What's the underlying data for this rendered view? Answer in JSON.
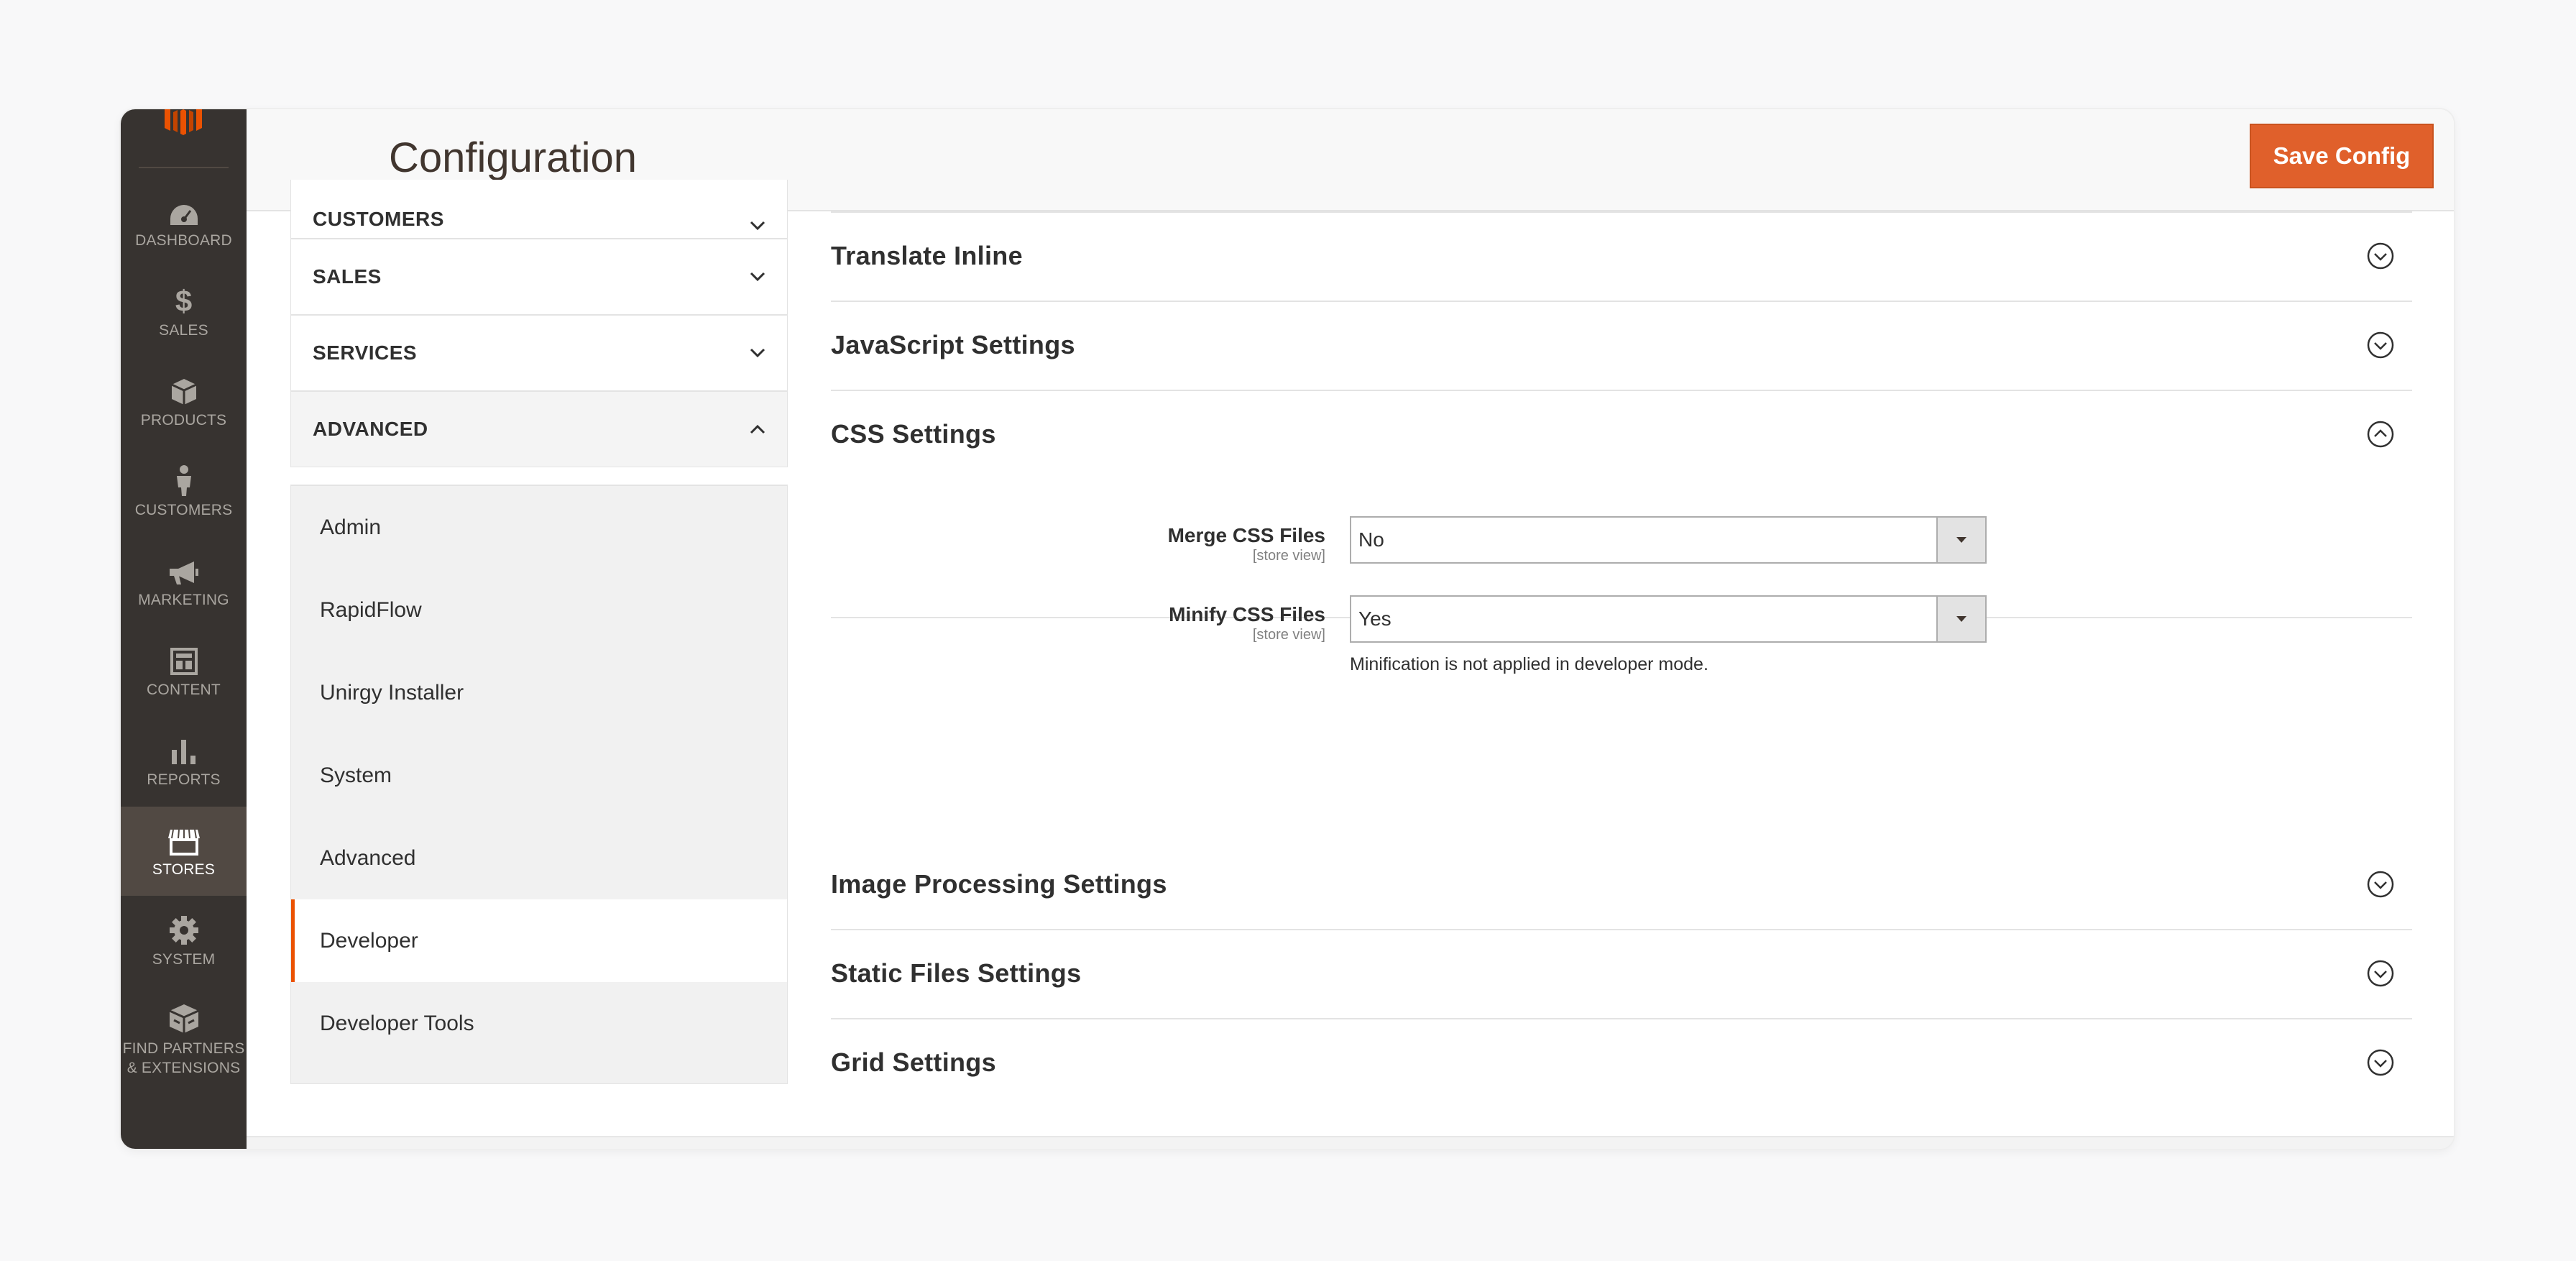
{
  "header": {
    "title": "Configuration",
    "save_label": "Save Config"
  },
  "nav": {
    "items": [
      {
        "label": "DASHBOARD",
        "icon": "dashboard-icon"
      },
      {
        "label": "SALES",
        "icon": "dollar-icon"
      },
      {
        "label": "PRODUCTS",
        "icon": "box-icon"
      },
      {
        "label": "CUSTOMERS",
        "icon": "person-icon"
      },
      {
        "label": "MARKETING",
        "icon": "megaphone-icon"
      },
      {
        "label": "CONTENT",
        "icon": "layout-icon"
      },
      {
        "label": "REPORTS",
        "icon": "bar-chart-icon"
      },
      {
        "label": "STORES",
        "icon": "store-icon"
      },
      {
        "label": "SYSTEM",
        "icon": "gear-icon"
      },
      {
        "label": "FIND PARTNERS & EXTENSIONS",
        "icon": "extensions-icon"
      }
    ],
    "active": "STORES"
  },
  "tabs": {
    "groups": [
      {
        "label": "CUSTOMERS"
      },
      {
        "label": "SALES"
      },
      {
        "label": "SERVICES"
      },
      {
        "label": "ADVANCED"
      }
    ],
    "advanced_items": [
      {
        "label": "Admin"
      },
      {
        "label": "RapidFlow"
      },
      {
        "label": "Unirgy Installer"
      },
      {
        "label": "System"
      },
      {
        "label": "Advanced"
      },
      {
        "label": "Developer"
      },
      {
        "label": "Developer Tools"
      }
    ],
    "active_item": "Developer"
  },
  "sections": {
    "translate_inline": "Translate Inline",
    "javascript": "JavaScript Settings",
    "css": "CSS Settings",
    "image_processing": "Image Processing Settings",
    "static_files": "Static Files Settings",
    "grid": "Grid Settings"
  },
  "css_fields": [
    {
      "label": "Merge CSS Files",
      "scope": "[store view]",
      "value": "No"
    },
    {
      "label": "Minify CSS Files",
      "scope": "[store view]",
      "value": "Yes",
      "note": "Minification is not applied in developer mode."
    }
  ],
  "colors": {
    "accent": "#eb5202",
    "button": "#e0602b",
    "nav_bg": "#373330"
  }
}
